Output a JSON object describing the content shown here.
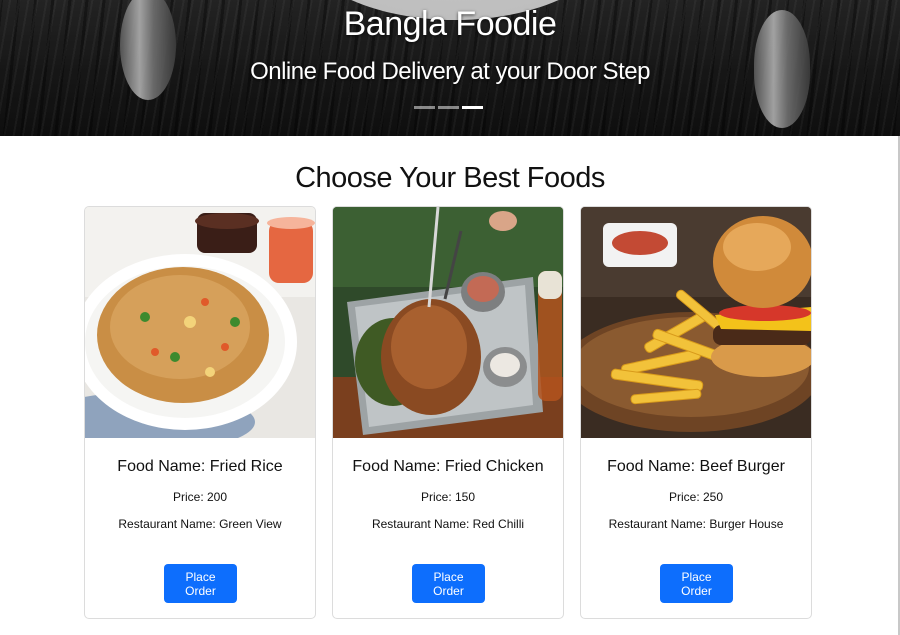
{
  "hero": {
    "title": "Bangla Foodie",
    "subtitle": "Online Food Delivery at your Door Step",
    "slides": 3,
    "active_slide": 3
  },
  "section": {
    "title": "Choose Your Best Foods"
  },
  "foods": [
    {
      "name": "Food Name: Fried Rice",
      "price": "Price: 200",
      "restaurant": "Restaurant Name: Green View",
      "button": "Place Order",
      "image": "fried-rice-image"
    },
    {
      "name": "Food Name: Fried Chicken",
      "price": "Price: 150",
      "restaurant": "Restaurant Name: Red Chilli",
      "button": "Place Order",
      "image": "fried-chicken-image"
    },
    {
      "name": "Food Name: Beef Burger",
      "price": "Price: 250",
      "restaurant": "Restaurant Name: Burger House",
      "button": "Place Order",
      "image": "beef-burger-image"
    }
  ],
  "colors": {
    "primary_button": "#0d6efd",
    "card_border": "#dcdcdc"
  }
}
